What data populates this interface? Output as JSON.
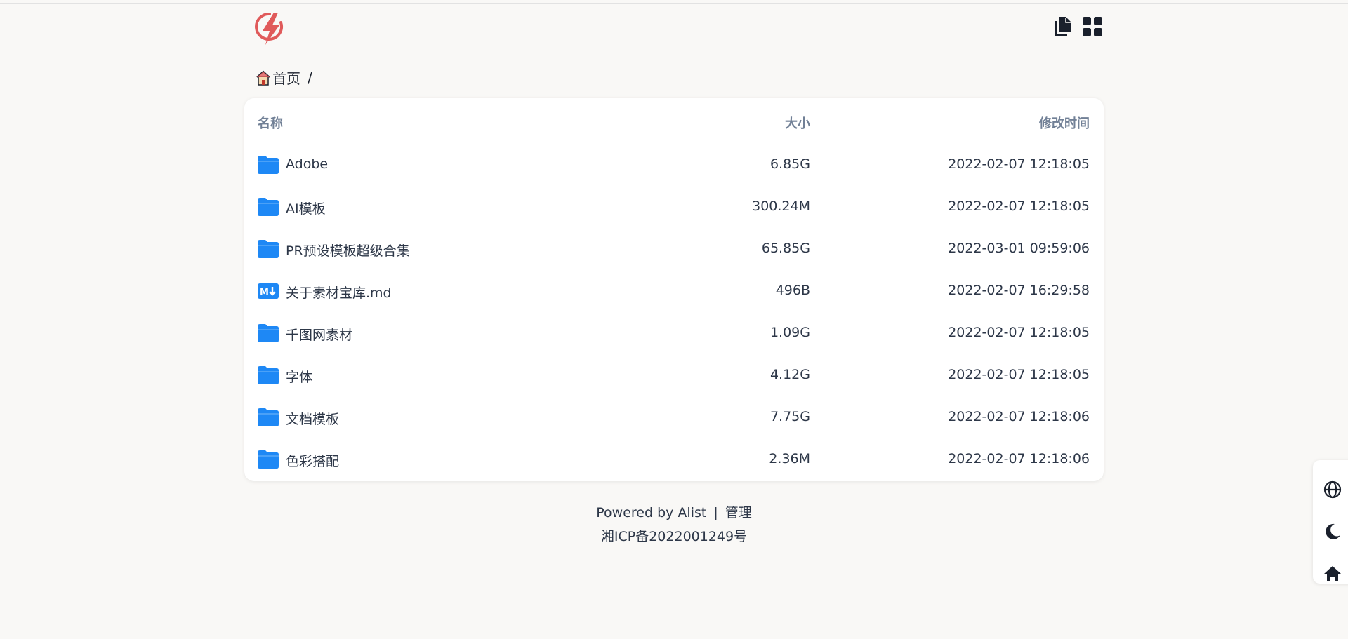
{
  "breadcrumb": {
    "home_label": "首页",
    "separator": "/"
  },
  "header": {
    "icons": [
      "copy-icon",
      "grid-view-icon"
    ]
  },
  "table": {
    "columns": {
      "name": "名称",
      "size": "大小",
      "modified": "修改时间"
    },
    "rows": [
      {
        "icon": "folder-icon",
        "name": "Adobe",
        "size": "6.85G",
        "modified": "2022-02-07 12:18:05"
      },
      {
        "icon": "folder-icon",
        "name": "AI模板",
        "size": "300.24M",
        "modified": "2022-02-07 12:18:05"
      },
      {
        "icon": "folder-icon",
        "name": "PR预设模板超级合集",
        "size": "65.85G",
        "modified": "2022-03-01 09:59:06"
      },
      {
        "icon": "markdown-icon",
        "name": "关于素材宝库.md",
        "size": "496B",
        "modified": "2022-02-07 16:29:58"
      },
      {
        "icon": "folder-icon",
        "name": "千图网素材",
        "size": "1.09G",
        "modified": "2022-02-07 12:18:05"
      },
      {
        "icon": "folder-icon",
        "name": "字体",
        "size": "4.12G",
        "modified": "2022-02-07 12:18:05"
      },
      {
        "icon": "folder-icon",
        "name": "文档模板",
        "size": "7.75G",
        "modified": "2022-02-07 12:18:06"
      },
      {
        "icon": "folder-icon",
        "name": "色彩搭配",
        "size": "2.36M",
        "modified": "2022-02-07 12:18:06"
      }
    ]
  },
  "footer": {
    "powered_by": "Powered by Alist",
    "separator": "|",
    "manage_link": "管理",
    "icp": "湘ICP备2022001249号"
  },
  "side_tools": [
    "globe-icon",
    "moon-icon",
    "home-icon"
  ],
  "colors": {
    "background": "#f9f8f6",
    "accent_folder": "#1e88f5",
    "logo": "#e05a5a",
    "header_text": "#718096"
  }
}
